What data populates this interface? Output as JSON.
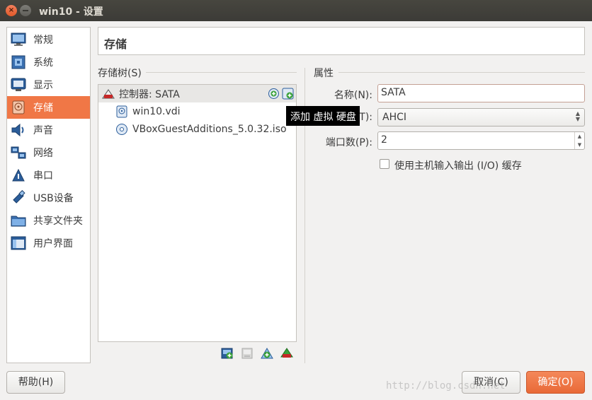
{
  "window": {
    "title": "win10 - 设置",
    "close_glyph": "×"
  },
  "sidebar": {
    "items": [
      {
        "label": "常规",
        "icon": "monitor-icon"
      },
      {
        "label": "系统",
        "icon": "chip-icon"
      },
      {
        "label": "显示",
        "icon": "display-icon"
      },
      {
        "label": "存储",
        "icon": "disk-icon"
      },
      {
        "label": "声音",
        "icon": "speaker-icon"
      },
      {
        "label": "网络",
        "icon": "network-icon"
      },
      {
        "label": "串口",
        "icon": "serial-port-icon"
      },
      {
        "label": "USB设备",
        "icon": "usb-icon"
      },
      {
        "label": "共享文件夹",
        "icon": "folder-icon"
      },
      {
        "label": "用户界面",
        "icon": "ui-icon"
      }
    ],
    "selected": "存储"
  },
  "header": {
    "title": "存储"
  },
  "storage_tree": {
    "label": "存储树(S)",
    "controller": "控制器: SATA",
    "items": [
      {
        "label": "win10.vdi",
        "icon": "hard-disk-icon"
      },
      {
        "label": "VBoxGuestAdditions_5.0.32.iso",
        "icon": "optical-disc-icon"
      }
    ]
  },
  "tooltip": {
    "text": "添加 虚拟 硬盘"
  },
  "properties": {
    "label": "属性",
    "name_label": "名称(N):",
    "name_value": "SATA",
    "type_label": "T):",
    "type_value": "AHCI",
    "port_label": "端口数(P):",
    "port_value": "2",
    "cache_label": "使用主机输入输出 (I/O) 缓存"
  },
  "buttons": {
    "help": "帮助(H)",
    "cancel": "取消(C)",
    "ok": "确定(O)"
  },
  "watermark": "http://blog.csdn.net",
  "colors": {
    "accent": "#f07746",
    "titlebar": "#3c3b37"
  }
}
